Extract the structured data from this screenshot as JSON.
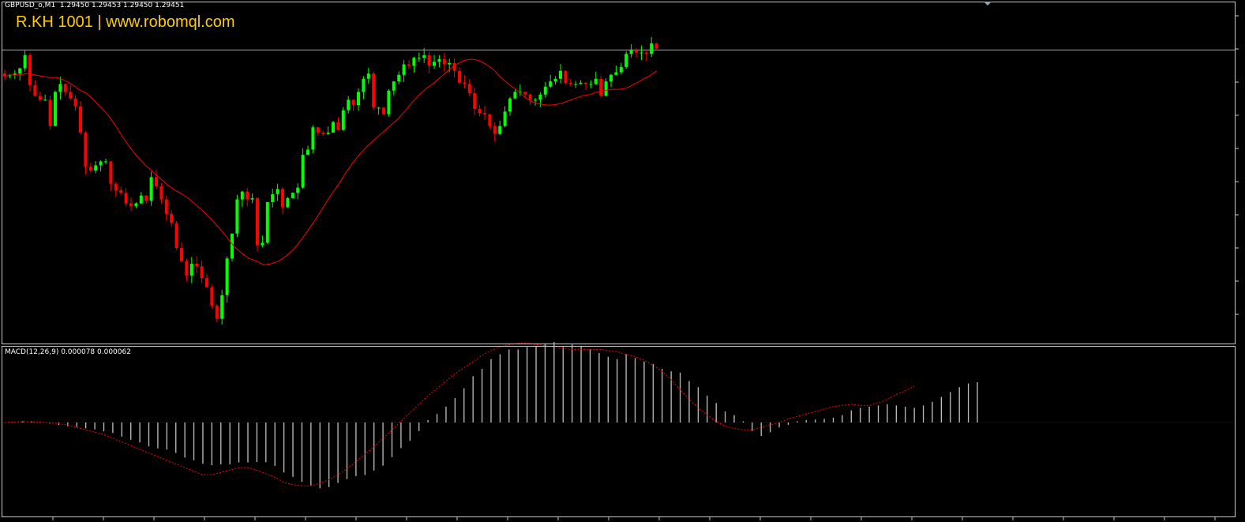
{
  "header": {
    "symbol_info": "GBPUSD_o,M1  1.29450 1.29453 1.29450 1.29451",
    "watermark": "R.KH 1001 | www.robomql.com"
  },
  "macd_header": {
    "label": "MACD(12,26,9) 0.000078 0.000062"
  },
  "colors": {
    "background": "#000000",
    "bull": "#00ff00",
    "bear": "#ff0000",
    "wick": "#00ff00",
    "ma_line": "#ff0000",
    "price_line": "#9aa3ad",
    "frame": "#c8c8c8",
    "histogram": "#c0c0c0",
    "signal": "#ff0000",
    "watermark": "#ffcc00"
  },
  "chart_data": [
    {
      "type": "candlestick",
      "title": "GBPUSD_o,M1",
      "ohlc_last": {
        "open": 1.2945,
        "high": 1.29453,
        "low": 1.2945,
        "close": 1.29451
      },
      "price_anchor": [
        1.2945,
        1.29451
      ],
      "series": [
        {
          "name": "price",
          "close": [
            1.2943,
            1.29431,
            1.29432,
            1.29436,
            1.29446,
            1.29423,
            1.29415,
            1.29412,
            1.29412,
            1.29392,
            1.29418,
            1.29424,
            1.29418,
            1.29413,
            1.29407,
            1.29387,
            1.29361,
            1.29358,
            1.29362,
            1.29365,
            1.29365,
            1.29348,
            1.29343,
            1.29341,
            1.29333,
            1.29331,
            1.29333,
            1.29339,
            1.29335,
            1.29353,
            1.29346,
            1.29336,
            1.29325,
            1.29318,
            1.29299,
            1.29289,
            1.29278,
            1.29287,
            1.29285,
            1.29276,
            1.29269,
            1.29255,
            1.29245,
            1.29263,
            1.29291,
            1.2931,
            1.29336,
            1.29342,
            1.29336,
            1.29337,
            1.29301,
            1.29303,
            1.29334,
            1.2934,
            1.29344,
            1.2933,
            1.29337,
            1.29341,
            1.29345,
            1.2937,
            1.29374,
            1.29391,
            1.29387,
            1.29386,
            1.29387,
            1.29395,
            1.29389,
            1.29404,
            1.29412,
            1.29408,
            1.29418,
            1.29428,
            1.29432,
            1.29406,
            1.29406,
            1.29401,
            1.29419,
            1.29426,
            1.29431,
            1.29439,
            1.29438,
            1.29444,
            1.29444,
            1.29446,
            1.29438,
            1.29441,
            1.29443,
            1.29439,
            1.2944,
            1.29434,
            1.29425,
            1.29424,
            1.29417,
            1.29405,
            1.29402,
            1.29401,
            1.29392,
            1.29386,
            1.29392,
            1.29403,
            1.29413,
            1.29418,
            1.29418,
            1.29416,
            1.29412,
            1.29412,
            1.29416,
            1.29422,
            1.29426,
            1.29428,
            1.29434,
            1.29425,
            1.29424,
            1.29424,
            1.29425,
            1.29424,
            1.29424,
            1.29428,
            1.29415,
            1.29426,
            1.29431,
            1.29433,
            1.29437,
            1.29447,
            1.2945,
            1.29448,
            1.29448,
            1.29447,
            1.29455,
            1.29451
          ]
        },
        {
          "name": "ma",
          "values": [
            1.2943,
            1.29431,
            1.29431,
            1.29432,
            1.29431,
            1.2943,
            1.29429,
            1.29429,
            1.29427,
            1.29424,
            1.2942,
            1.29417,
            1.29412,
            1.29406,
            1.294,
            1.29392,
            1.29383,
            1.29375,
            1.29368,
            1.29362,
            1.29357,
            1.29352,
            1.29347,
            1.29343,
            1.2934,
            1.29336,
            1.29331,
            1.29326,
            1.2932,
            1.29314,
            1.29307,
            1.293,
            1.29295,
            1.29291,
            1.29289,
            1.29286,
            1.29287,
            1.29289,
            1.29293,
            1.29298,
            1.29305,
            1.29313,
            1.29321,
            1.2933,
            1.29339,
            1.29347,
            1.29356,
            1.29364,
            1.29371,
            1.29377,
            1.29382,
            1.29387,
            1.29392,
            1.29397,
            1.29403,
            1.2941,
            1.29416,
            1.29421,
            1.29425,
            1.2943,
            1.29435,
            1.29439,
            1.29442,
            1.29443,
            1.29442,
            1.29439,
            1.29435,
            1.29429,
            1.29424,
            1.2942,
            1.29415,
            1.29411,
            1.29409,
            1.29408,
            1.29408,
            1.29409,
            1.29411,
            1.29413,
            1.29415,
            1.29416,
            1.29418,
            1.29419,
            1.2942,
            1.2942,
            1.29421,
            1.29424,
            1.29427,
            1.2943,
            1.29434
          ]
        }
      ]
    },
    {
      "type": "bar",
      "title": "MACD(12,26,9)",
      "values_last": {
        "macd": 7.8e-05,
        "signal": 6.2e-05
      },
      "series": [
        {
          "name": "macd",
          "values": [
            0.0,
            0.1,
            0.5,
            0.45,
            0.2,
            -0.5,
            -1,
            -1.5,
            -1.8,
            -2.4,
            -2.8,
            -3.6,
            -4.3,
            -5.8,
            -7.1,
            -8.2,
            -9.8,
            -10.6,
            -11.1,
            -12.5,
            -14.4,
            -15.5,
            -16.9,
            -17.5,
            -17.2,
            -17.2,
            -16.4,
            -16.4,
            -16.2,
            -16.3,
            -17.8,
            -20.5,
            -22.3,
            -24.4,
            -25.8,
            -27.0,
            -26.5,
            -24.8,
            -23.2,
            -22.0,
            -21.5,
            -19.7,
            -17.7,
            -14.2,
            -10.5,
            -7.5,
            -3.5,
            1.0,
            3.5,
            6.5,
            10.0,
            14.0,
            19.0,
            22.0,
            26.0,
            28.0,
            30.0,
            30.0,
            31.0,
            31.5,
            32.5,
            33.0,
            31.0,
            32.0,
            31.5,
            30.0,
            28.5,
            27.0,
            26.0,
            28.0,
            26.5,
            25.0,
            24.0,
            22.0,
            21.0,
            20.5,
            17.0,
            14.5,
            11.0,
            8.0,
            4.5,
            3.0,
            0.5,
            -3.5,
            -5.5,
            -4.0,
            -2.0,
            -1.0,
            0.5,
            1.0,
            1.2,
            1.5,
            2.0,
            3.0,
            5.0,
            6.0,
            6.5,
            7.0,
            7.5,
            7.0,
            6.5,
            6.0,
            7.0,
            8.5,
            10.5,
            12.5,
            14.5,
            16.0,
            16.5
          ]
        },
        {
          "name": "signal",
          "values": [
            0.0,
            0.15,
            0.35,
            0.3,
            0.15,
            -0.2,
            -0.5,
            -1,
            -2,
            -3,
            -4,
            -5,
            -6.5,
            -8,
            -9.5,
            -11,
            -12.5,
            -14,
            -15.5,
            -17,
            -18.5,
            -20,
            -21.5,
            -21.5,
            -20.5,
            -19.5,
            -18.5,
            -18.5,
            -19.5,
            -21,
            -22.5,
            -24.5,
            -25.5,
            -26,
            -26,
            -25,
            -23.5,
            -21.5,
            -19,
            -16,
            -13,
            -10,
            -6.5,
            -3,
            0.5,
            4,
            7.5,
            11,
            14,
            17,
            20,
            22.5,
            25,
            27.5,
            29.5,
            31,
            32,
            32.5,
            32.5,
            32,
            31.5,
            31,
            30.5,
            30,
            30,
            30,
            30,
            29.5,
            29,
            28,
            27,
            25.5,
            23.5,
            21,
            17.5,
            13.5,
            9.5,
            6,
            3,
            0.5,
            -1.5,
            -2.5,
            -3,
            -3,
            -2,
            -1,
            0,
            1.5,
            2.5,
            3.5,
            4.5,
            5.5,
            6.5,
            7,
            7.5,
            7,
            7,
            8,
            9.5,
            11.5,
            13,
            15
          ]
        }
      ]
    }
  ]
}
